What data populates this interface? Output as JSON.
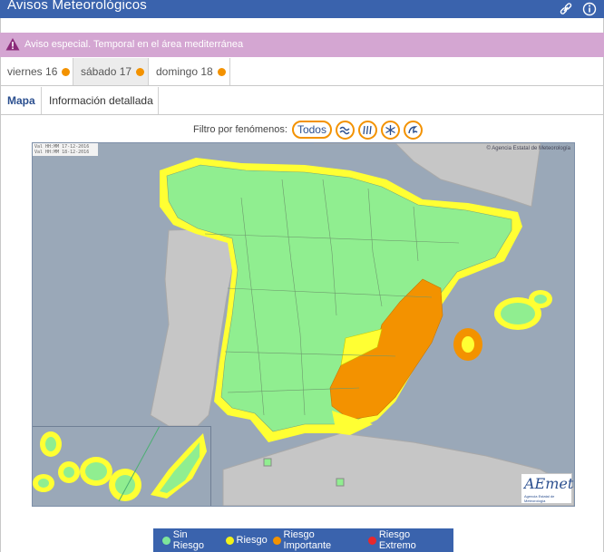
{
  "header": {
    "title": "Avisos Meteorológicos",
    "icons": [
      "link-icon",
      "info-icon"
    ]
  },
  "alert": {
    "text": "Aviso especial. Temporal en el área mediterránea",
    "icon": "warning-icon"
  },
  "day_tabs": [
    {
      "label": "viernes 16",
      "active": false,
      "status_color": "#f39200"
    },
    {
      "label": "sábado 17",
      "active": true,
      "status_color": "#f39200"
    },
    {
      "label": "domingo 18",
      "active": false,
      "status_color": "#f39200"
    }
  ],
  "view_tabs": [
    {
      "label": "Mapa",
      "active": true
    },
    {
      "label": "Información detallada",
      "active": false
    }
  ],
  "filter": {
    "label": "Filtro por fenómenos:",
    "all_label": "Todos",
    "buttons": [
      "wind-icon",
      "rain-icon",
      "snow-icon",
      "coast-icon"
    ]
  },
  "map": {
    "date_line_1": "Val HH:MM 17-12-2016",
    "date_line_2": "Val HH:MM 18-12-2016",
    "copyright": "© Agencia Estatal de Meteorología",
    "logo_text": "AEmet",
    "logo_subtext": "Agencia Estatal de Meteorología"
  },
  "legend": [
    {
      "label": "Sin Riesgo",
      "color": "#7ee59a"
    },
    {
      "label": "Riesgo",
      "color": "#f2f21a"
    },
    {
      "label": "Riesgo Importante",
      "color": "#f39200"
    },
    {
      "label": "Riesgo Extremo",
      "color": "#e8282c"
    }
  ],
  "colors": {
    "header": "#3a63ad",
    "alert": "#d4a6d2",
    "green": "#90ee90",
    "yellow": "#ffff33",
    "orange": "#f39200"
  }
}
